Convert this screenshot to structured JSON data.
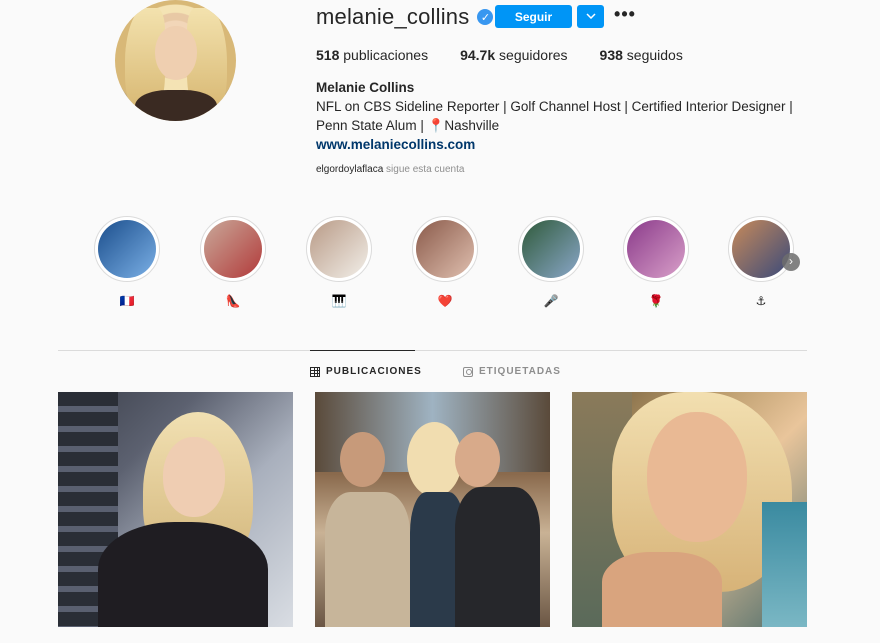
{
  "profile": {
    "username": "melanie_collins",
    "verified": true,
    "follow_label": "Seguir",
    "dropdown_icon": "chevron-down-icon",
    "more_icon": "more-icon",
    "more_label": "•••",
    "stats": {
      "posts_count": "518",
      "posts_label": "publicaciones",
      "followers_count": "94.7k",
      "followers_label": "seguidores",
      "following_count": "938",
      "following_label": "seguidos"
    },
    "full_name": "Melanie Collins",
    "bio_line1": "NFL on CBS Sideline Reporter | Golf Channel Host | Certified Interior Designer |",
    "bio_line2_a": "Penn State Alum | ",
    "bio_pin": "📍",
    "bio_line2_b": "Nashville",
    "website": "www.melaniecollins.com",
    "followed_by_user": "elgordoylaflaca",
    "followed_by_text": "sigue esta cuenta",
    "accent_color": "#0095f6"
  },
  "highlights": [
    {
      "label": "🇫🇷",
      "colors": [
        "#1b4e8c",
        "#7bb0e6"
      ]
    },
    {
      "label": "👠",
      "colors": [
        "#c9a99a",
        "#b23a3a"
      ]
    },
    {
      "label": "🎹",
      "colors": [
        "#b89a86",
        "#f2efe9"
      ]
    },
    {
      "label": "❤️",
      "colors": [
        "#8a5a4a",
        "#e0c0b0"
      ]
    },
    {
      "label": "🎤",
      "colors": [
        "#2f5a3a",
        "#8aa7c9"
      ]
    },
    {
      "label": "🌹",
      "colors": [
        "#8a3a8a",
        "#d9a0c9"
      ]
    },
    {
      "label": "⚓",
      "colors": [
        "#c78a5a",
        "#3a4a7a"
      ]
    }
  ],
  "tabs": [
    {
      "label": "PUBLICACIONES",
      "icon": "grid-icon",
      "active": true
    },
    {
      "label": "ETIQUETADAS",
      "icon": "tag-icon",
      "active": false
    }
  ],
  "posts": [
    {
      "name": "post-1"
    },
    {
      "name": "post-2"
    },
    {
      "name": "post-3"
    }
  ]
}
